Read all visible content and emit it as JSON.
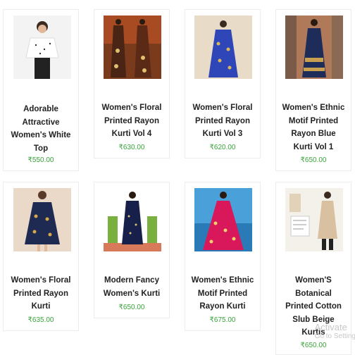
{
  "products": [
    {
      "title": [
        "Adorable",
        "Attractive",
        "Women's White",
        "Top"
      ],
      "price": "₹550.00",
      "image_alt": "white-top-photo"
    },
    {
      "title": [
        "Women's Floral",
        "Printed Rayon",
        "Kurti Vol 4"
      ],
      "price": "₹630.00",
      "image_alt": "floral-kurti-vol4-photo"
    },
    {
      "title": [
        "Women's Floral",
        "Printed Rayon",
        "Kurti Vol 3"
      ],
      "price": "₹620.00",
      "image_alt": "floral-kurti-vol3-photo"
    },
    {
      "title": [
        "Women's Ethnic",
        "Motif Printed",
        "Rayon Blue",
        "Kurti Vol 1"
      ],
      "price": "₹650.00",
      "image_alt": "blue-kurti-vol1-photo"
    },
    {
      "title": [
        "Women's Floral",
        "Printed Rayon",
        "Kurti"
      ],
      "price": "₹635.00",
      "image_alt": "floral-kurti-photo"
    },
    {
      "title": [
        "Modern Fancy",
        "Women's Kurti"
      ],
      "price": "₹650.00",
      "image_alt": "modern-fancy-kurti-photo"
    },
    {
      "title": [
        "Women's Ethnic",
        "Motif Printed",
        "Rayon Kurti"
      ],
      "price": "₹675.00",
      "image_alt": "ethnic-rayon-kurti-photo"
    },
    {
      "title": [
        "Women'S",
        "Botanical",
        "Printed Cotton",
        "Slub Beige",
        "Kurtis"
      ],
      "price": "₹650.00",
      "image_alt": "botanical-beige-kurti-photo"
    }
  ],
  "watermark": {
    "line1": "Activate",
    "line2": "Go to Settings"
  },
  "colors": {
    "price": "#3aa33a",
    "border": "#ececec"
  }
}
